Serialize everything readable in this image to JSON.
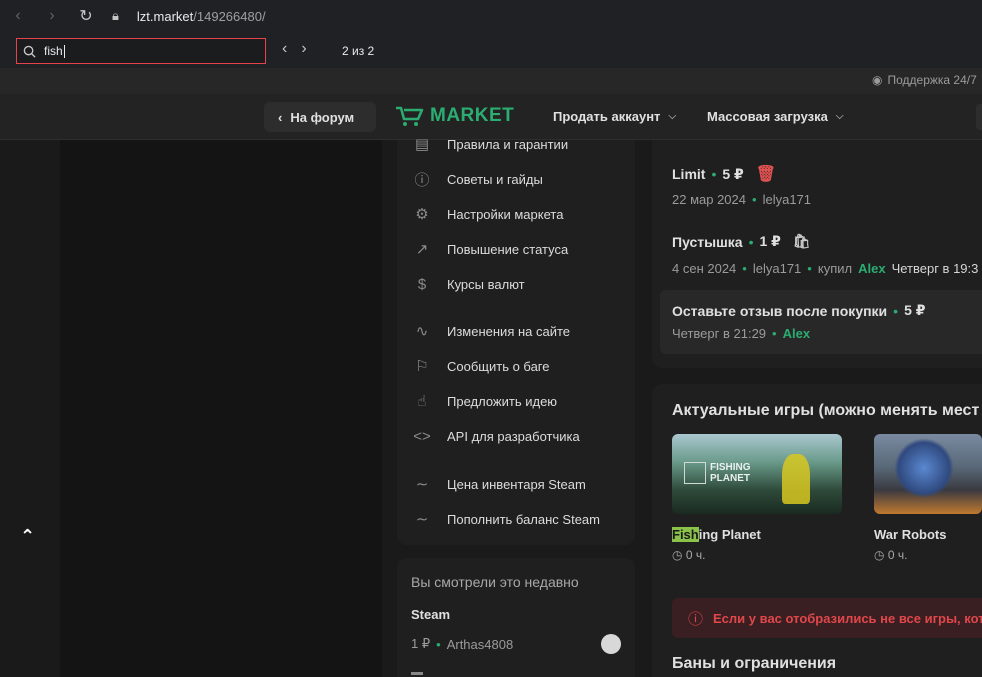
{
  "browser": {
    "url_host": "lzt.market",
    "url_path": "/149266480/",
    "find": {
      "query": "fish",
      "count": "2 из 2"
    }
  },
  "support": {
    "label": "Поддержка 24/7"
  },
  "header": {
    "back_label": "На форум",
    "brand": "MARKET",
    "nav": [
      "Продать аккаунт",
      "Массовая загрузка"
    ]
  },
  "sidebar": {
    "items": [
      {
        "icon": "book-icon",
        "label": "Правила и гарантии"
      },
      {
        "icon": "help-circle-icon",
        "label": "Советы и гайды"
      },
      {
        "icon": "gear-icon",
        "label": "Настройки маркета"
      },
      {
        "icon": "trending-up-icon",
        "label": "Повышение статуса"
      },
      {
        "icon": "dollar-icon",
        "label": "Курсы валют"
      },
      {
        "icon": "activity-icon",
        "label": "Изменения на сайте"
      },
      {
        "icon": "flag-icon",
        "label": "Сообщить о баге"
      },
      {
        "icon": "thumbs-up-icon",
        "label": "Предложить идею"
      },
      {
        "icon": "code-icon",
        "label": "API для разработчика"
      },
      {
        "icon": "steam-icon",
        "label": "Цена инвентаря Steam"
      },
      {
        "icon": "steam-icon",
        "label": "Пополнить баланс Steam"
      }
    ]
  },
  "recent": {
    "title": "Вы смотрели это недавно",
    "item_title": "Steam",
    "price": "1 ₽",
    "seller": "Arthas4808"
  },
  "sales": [
    {
      "title": "Limit",
      "price": "5 ₽",
      "date": "22 мар 2024",
      "user": "lelya171"
    },
    {
      "title": "Пустышка",
      "price": "1 ₽",
      "date": "4 сен 2024",
      "user": "lelya171",
      "bought_prefix": "купил",
      "buyer": "Alex",
      "bought_when": "Четверг в 19:3"
    },
    {
      "title": "Оставьте отзыв после покупки",
      "price": "5 ₽",
      "date": "Четверг в 21:29",
      "user": "Alex"
    }
  ],
  "games": {
    "title": "Актуальные игры (можно менять мест",
    "items": [
      {
        "name_highlight": "Fish",
        "name_rest": "ing Planet",
        "hours": "0 ч.",
        "thumb_text_1": "FISHING",
        "thumb_text_2": "PLANET"
      },
      {
        "name": "War Robots",
        "hours": "0 ч."
      }
    ]
  },
  "alert": {
    "text": "Если у вас отобразились не все игры, кот"
  },
  "bans": {
    "title": "Баны и ограничения"
  },
  "colors": {
    "accent": "#2bad72",
    "danger": "#e0474a",
    "highlight": "#8ac24a"
  }
}
